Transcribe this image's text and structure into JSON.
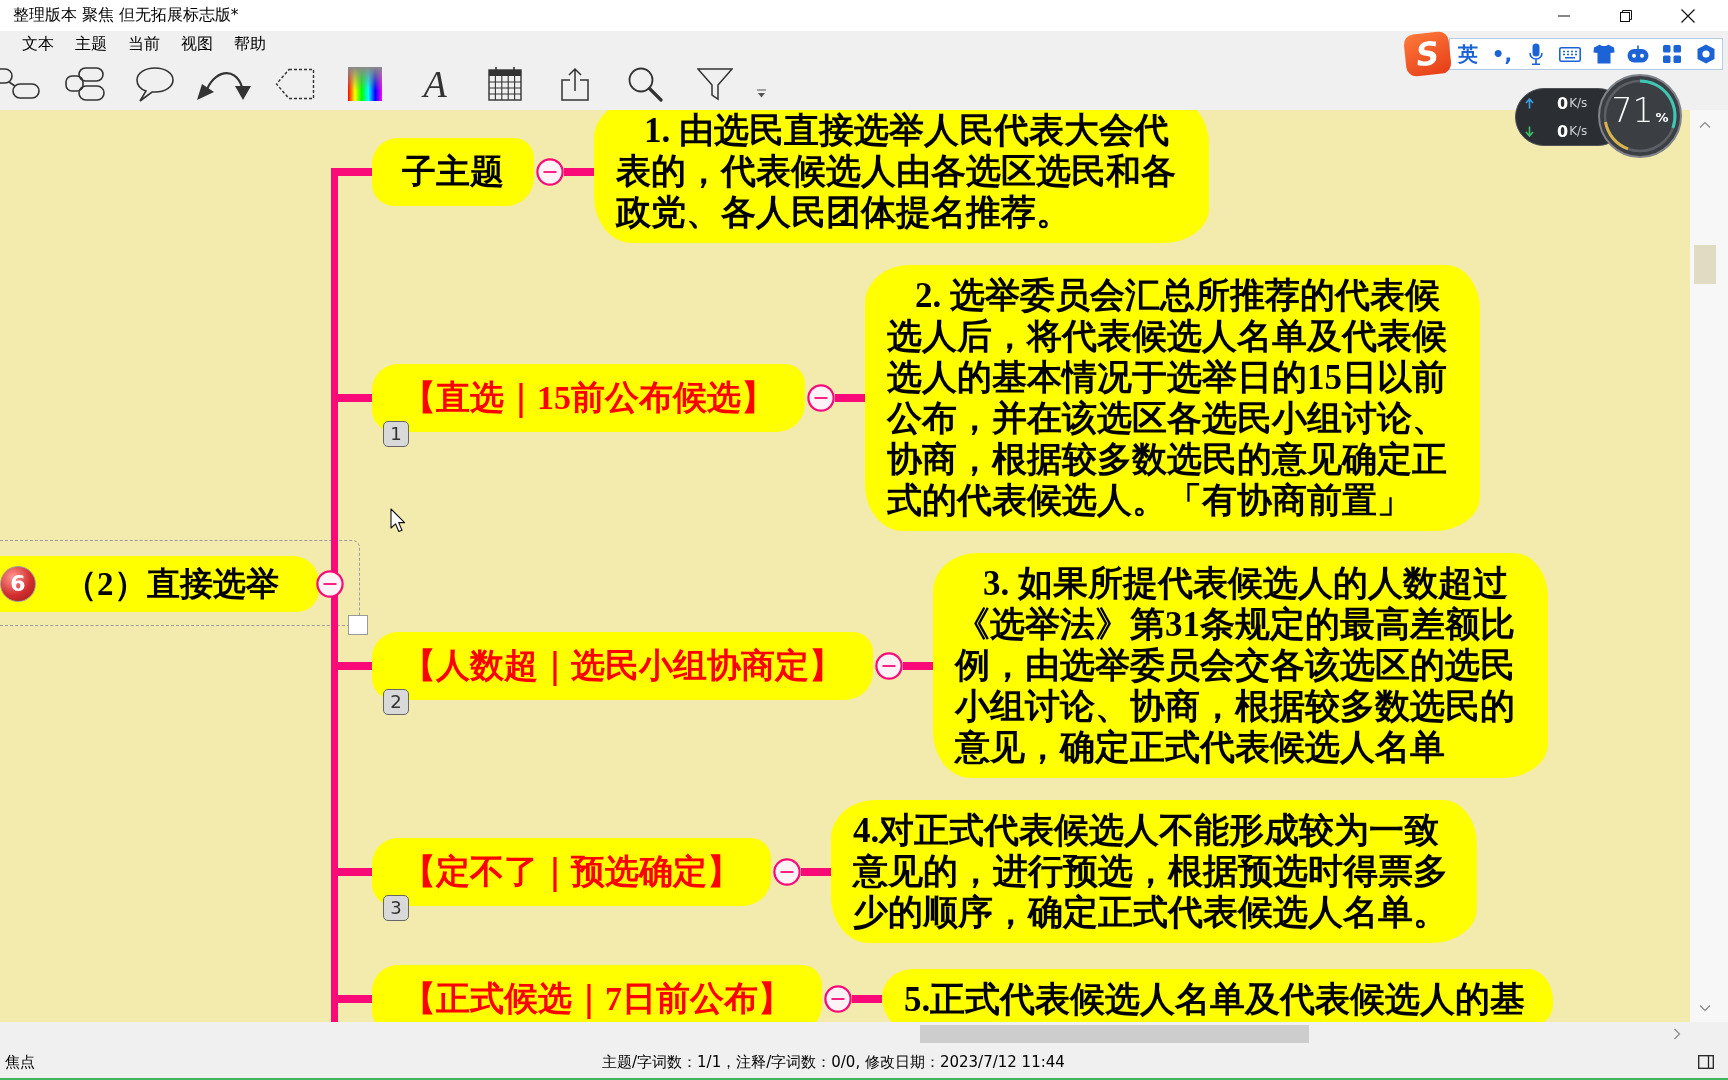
{
  "window": {
    "title": "整理版本 聚焦 但无拓展标志版*"
  },
  "menu": [
    "文本",
    "主题",
    "当前",
    "视图",
    "帮助"
  ],
  "toolbar": {
    "font_label": "A"
  },
  "ime_bar": {
    "logo": "S",
    "mode": "英",
    "punctuation": "•,"
  },
  "network_monitor": {
    "upload": {
      "value": "0",
      "unit": "K/s"
    },
    "download": {
      "value": "0",
      "unit": "K/s"
    },
    "usage": {
      "value": "71",
      "unit": "%"
    }
  },
  "map": {
    "root": {
      "marker": "6",
      "text": "（2）直接选举",
      "expanded": true
    },
    "children": [
      {
        "text": "子主题",
        "emphasized": false,
        "expanded": true,
        "note": {
          "text": "1. 由选民直接选举人民代表大会代表的，代表候选人由各选区选民和各政党、各人民团体提名推荐。",
          "indent": true
        }
      },
      {
        "text": "【直选｜15前公布候选】",
        "emphasized": true,
        "expanded": true,
        "marker": "1",
        "note": {
          "text": "2. 选举委员会汇总所推荐的代表候选人后，将代表候选人名单及代表候选人的基本情况于选举日的15日以前公布，并在该选区各选民小组讨论、协商，根据较多数选民的意见确定正式的代表候选人。「有协商前置」",
          "indent": true
        }
      },
      {
        "text": "【人数超｜选民小组协商定】",
        "emphasized": true,
        "expanded": true,
        "marker": "2",
        "note": {
          "text": "3. 如果所提代表候选人的人数超过《选举法》第31条规定的最高差额比例，由选举委员会交各该选区的选民小组讨论、协商，根据较多数选民的意见，确定正式代表候选人名单",
          "indent": true
        }
      },
      {
        "text": "【定不了｜预选确定】",
        "emphasized": true,
        "expanded": true,
        "marker": "3",
        "note": {
          "text": "4.对正式代表候选人不能形成较为一致意见的，进行预选，根据预选时得票多少的顺序，确定正式代表候选人名单。",
          "indent": false
        }
      },
      {
        "text": "【正式候选｜7日前公布】",
        "emphasized": true,
        "expanded": true,
        "note": {
          "text": "5.正式代表候选人名单及代表候选人的基",
          "indent": false
        }
      }
    ]
  },
  "status_bar": {
    "mode": "焦点",
    "info": "主题/字词数：1/1，注释/字词数：0/0, 修改日期：2023/7/12 11:44"
  }
}
